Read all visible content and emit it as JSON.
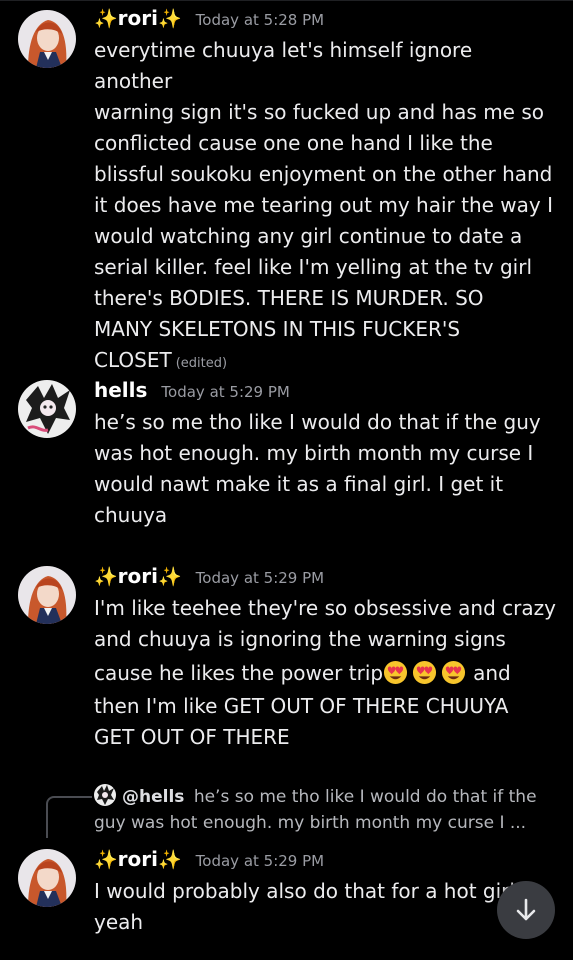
{
  "messages": [
    {
      "author": "rori",
      "sparkle_left": "✨",
      "sparkle_right": "✨",
      "time": "Today at 5:28 PM",
      "lines": [
        "everytime chuuya let's himself ignore another",
        "warning sign it's so fucked up and has me so",
        "conflicted cause one one hand I like the",
        "blissful soukoku enjoyment on the other hand",
        "it does have me tearing out my hair the way I",
        "would watching any girl continue to date a",
        "serial killer. feel like I'm yelling at the tv girl",
        "there's BODIES. THERE IS MURDER. SO",
        "MANY SKELETONS IN THIS FUCKER'S",
        "CLOSET"
      ],
      "edited_label": "(edited)"
    },
    {
      "author": "hells",
      "time": "Today at 5:29 PM",
      "lines": [
        "he’s so me tho like I would do that if the guy",
        "was hot enough. my birth month my curse I",
        "would nawt make it as a final girl. I get it",
        "chuuya"
      ]
    },
    {
      "author": "rori",
      "sparkle_left": "✨",
      "sparkle_right": "✨",
      "time": "Today at 5:29 PM",
      "lines": [
        "I'm like teehee they're so obsessive and crazy",
        "and chuuya is ignoring the warning signs",
        "cause he likes the power trip",
        "and",
        "then I'm like GET OUT OF THERE CHUUYA",
        "GET OUT OF THERE"
      ],
      "emoji": [
        "heart-eyes-emoji",
        "heart-eyes-emoji",
        "heart-eyes-emoji"
      ]
    },
    {
      "reply": {
        "mention": "@hells",
        "line1": "he’s so me tho like I would do that if the",
        "line2": "guy was hot enough. my birth month my curse I ..."
      },
      "author": "rori",
      "sparkle_left": "✨",
      "sparkle_right": "✨",
      "time": "Today at 5:29 PM",
      "lines": [
        "I would probably also do that for a hot girl",
        "yeah"
      ]
    }
  ],
  "scroll_button_icon": "arrow-down-icon",
  "colors": {
    "background": "#000000",
    "sparkle": "#f6c844",
    "timestamp": "#9a9ca3"
  }
}
